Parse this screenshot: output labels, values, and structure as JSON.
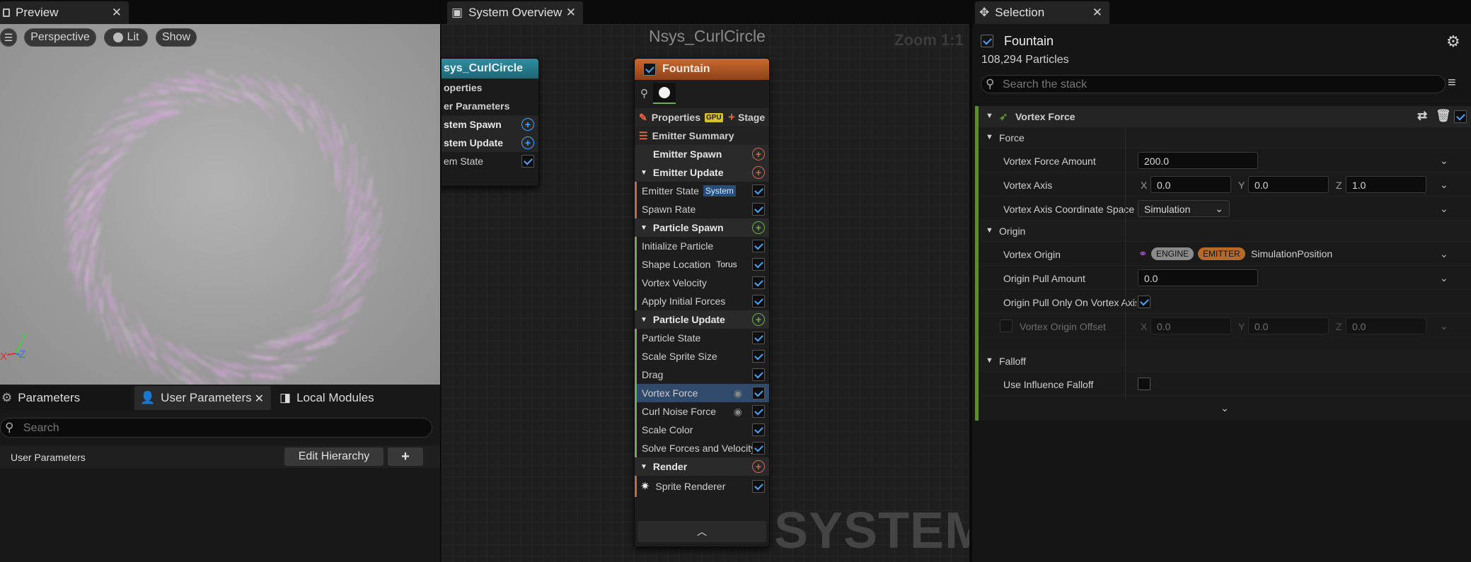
{
  "preview": {
    "tab_label": "Preview",
    "menu_icon": "hamburger-icon",
    "view_mode": "Perspective",
    "lit_label": "Lit",
    "show_label": "Show",
    "axis_y": "Y",
    "axis_x": "X",
    "axis_z": "Z"
  },
  "params": {
    "tabs": [
      {
        "label": "Parameters"
      },
      {
        "label": "User Parameters"
      },
      {
        "label": "Local Modules"
      }
    ],
    "search_placeholder": "Search",
    "section_label": "User Parameters",
    "edit_hierarchy_label": "Edit Hierarchy",
    "add_label": "+"
  },
  "graph": {
    "tab_label": "System Overview",
    "title": "Nsys_CurlCircle",
    "zoom": "Zoom 1:1",
    "watermark": "SYSTEM",
    "system_node": {
      "title": "sys_CurlCircle",
      "rows": [
        "operties",
        "er Parameters",
        "stem Spawn",
        "stem Update",
        "em State"
      ]
    },
    "emitter_node": {
      "title": "Fountain",
      "properties_label": "Properties",
      "gpu_badge": "GPU",
      "stage_label": "Stage",
      "emitter_summary": "Emitter Summary",
      "emitter_spawn": "Emitter Spawn",
      "emitter_update": "Emitter Update",
      "emitter_state": "Emitter State",
      "emitter_state_tag": "System",
      "spawn_rate": "Spawn Rate",
      "particle_spawn": "Particle Spawn",
      "spawn_modules": [
        {
          "label": "Initialize Particle",
          "tag": ""
        },
        {
          "label": "Shape Location",
          "tag": "Torus"
        },
        {
          "label": "Vortex Velocity",
          "tag": ""
        },
        {
          "label": "Apply Initial Forces",
          "tag": ""
        }
      ],
      "particle_update": "Particle Update",
      "update_modules": [
        {
          "label": "Particle State"
        },
        {
          "label": "Scale Sprite Size"
        },
        {
          "label": "Drag"
        },
        {
          "label": "Vortex Force"
        },
        {
          "label": "Curl Noise Force"
        },
        {
          "label": "Scale Color"
        },
        {
          "label": "Solve Forces and Velocity"
        }
      ],
      "render": "Render",
      "sprite_renderer": "Sprite Renderer"
    }
  },
  "selection": {
    "tab_label": "Selection",
    "emitter_name": "Fountain",
    "particle_count": "108,294 Particles",
    "search_placeholder": "Search the stack",
    "module_title": "Vortex Force",
    "cat_force": "Force",
    "cat_origin": "Origin",
    "cat_falloff": "Falloff",
    "vortex_force_amount_label": "Vortex Force Amount",
    "vortex_force_amount": "200.0",
    "vortex_axis_label": "Vortex Axis",
    "vortex_axis_x": "0.0",
    "vortex_axis_y": "0.0",
    "vortex_axis_z": "1.0",
    "axis_x": "X",
    "axis_y": "Y",
    "axis_z": "Z",
    "coord_space_label": "Vortex Axis Coordinate Space",
    "coord_space": "Simulation",
    "vortex_origin_label": "Vortex Origin",
    "engine_badge": "ENGINE",
    "emitter_badge": "EMITTER",
    "vortex_origin_value": "SimulationPosition",
    "origin_pull_amount_label": "Origin Pull Amount",
    "origin_pull_amount": "0.0",
    "origin_pull_only_label": "Origin Pull Only On Vortex Axis",
    "origin_offset_label": "Vortex Origin Offset",
    "origin_offset_x": "0.0",
    "origin_offset_y": "0.0",
    "origin_offset_z": "0.0",
    "use_falloff_label": "Use Influence Falloff"
  },
  "colors": {
    "accent_blue": "#4aa3ff",
    "emitter_orange": "#b85a27",
    "system_teal": "#2a7d8f",
    "particle_pink": "#e3a6ec",
    "engine_badge": "#8a8a8a",
    "emitter_badge": "#b36b2c",
    "module_green": "#5c8a3a"
  }
}
